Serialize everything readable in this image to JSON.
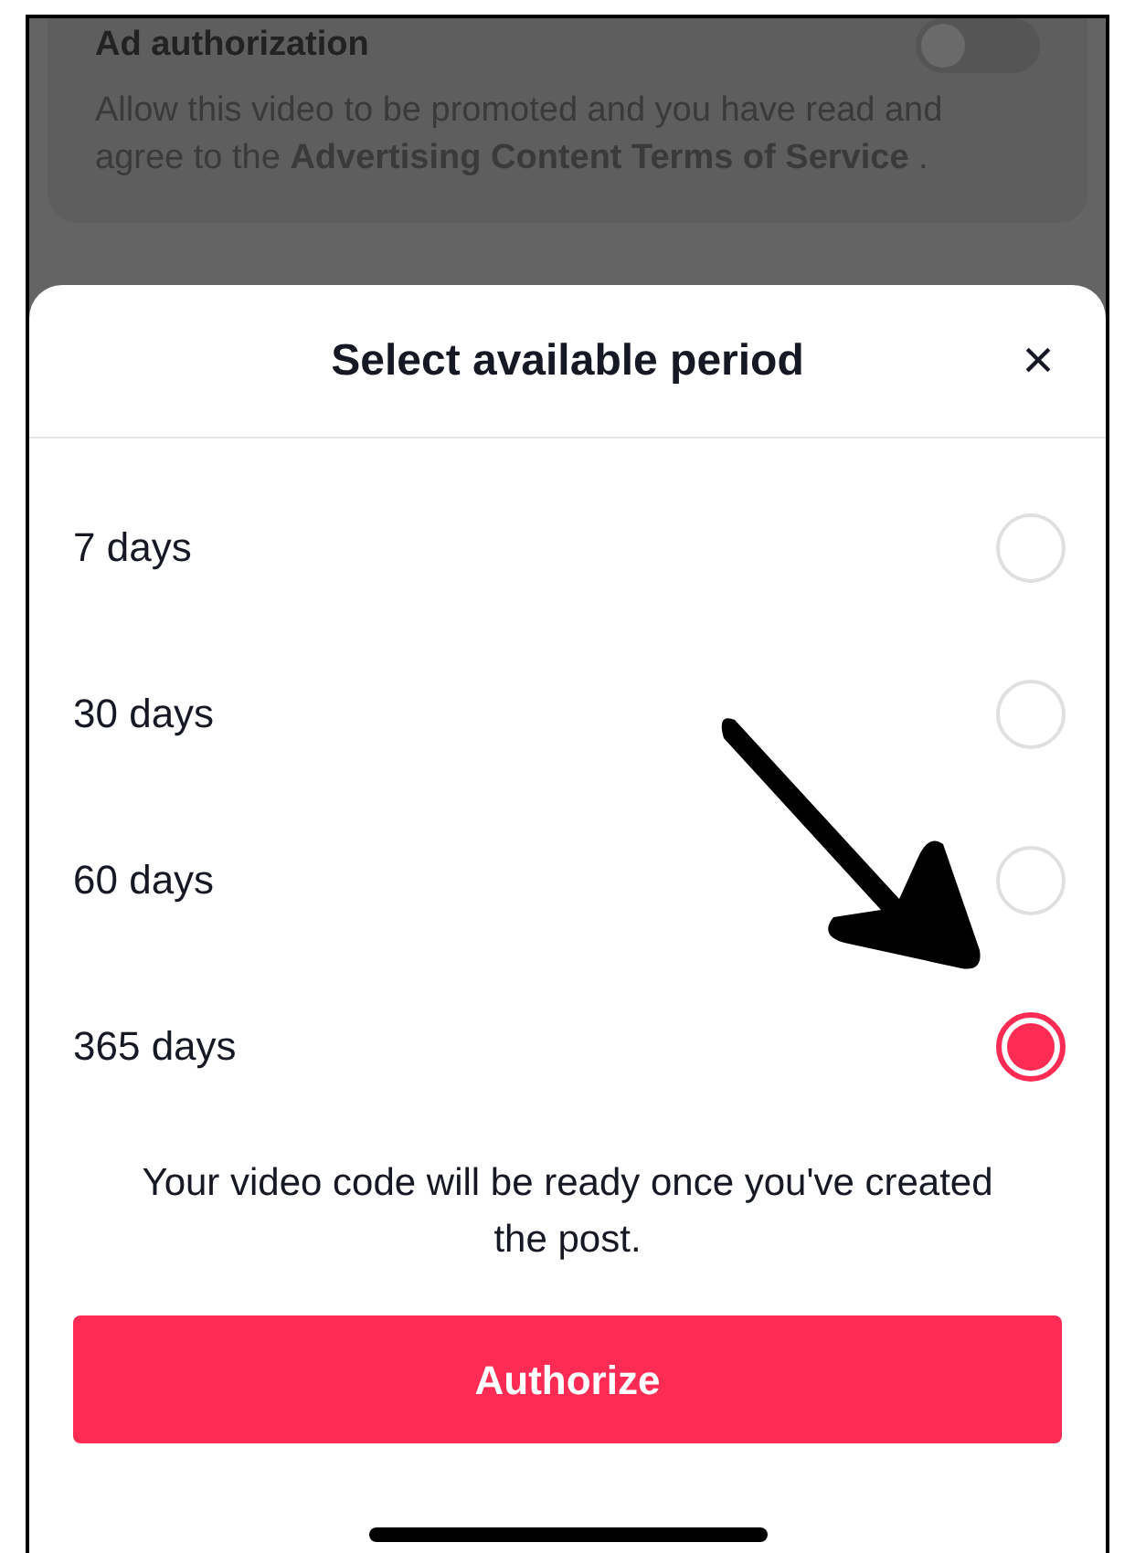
{
  "background_setting": {
    "title": "Ad authorization",
    "on": false,
    "description": "Allow this video to be promoted and you have read and agree to the **Advertising Content Terms of Service** ."
  },
  "sheet": {
    "title": "Select available period",
    "close": "×",
    "options": [
      {
        "label": "7 days",
        "selected": false
      },
      {
        "label": "30 days",
        "selected": false
      },
      {
        "label": "60 days",
        "selected": false
      },
      {
        "label": "365 days",
        "selected": true
      }
    ],
    "note": "Your video code will be ready once you've created the post.",
    "button": "Authorize"
  }
}
